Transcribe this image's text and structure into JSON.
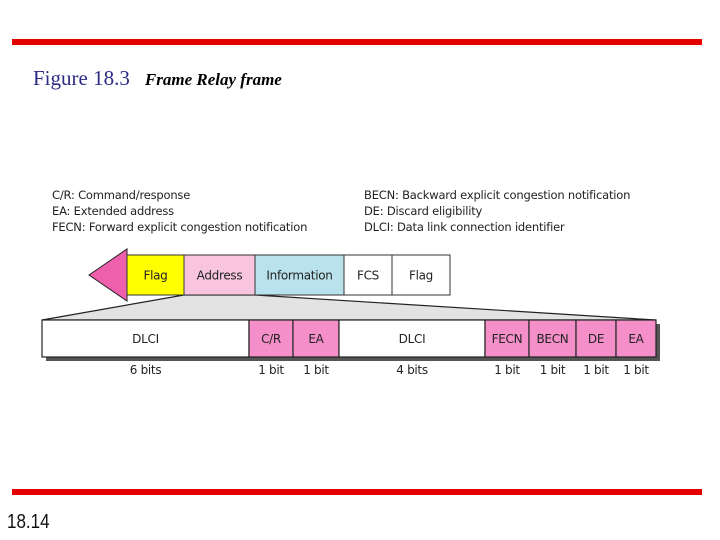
{
  "header": {
    "figure_number": "Figure 18.3",
    "figure_caption": "Frame Relay frame"
  },
  "legend": {
    "left": [
      "C/R: Command/response",
      "EA: Extended address",
      "FECN: Forward explicit congestion notification"
    ],
    "right": [
      "BECN: Backward explicit congestion notification",
      "DE: Discard eligibility",
      "DLCI: Data link connection identifier"
    ]
  },
  "frame": {
    "fields": [
      {
        "label": "Flag",
        "color": "#ffff00"
      },
      {
        "label": "Address",
        "color": "#f9c4de"
      },
      {
        "label": "Information",
        "color": "#b9e2ec"
      },
      {
        "label": "FCS",
        "color": "#ffffff"
      },
      {
        "label": "Flag",
        "color": "#ffffff"
      }
    ],
    "arrow_color": "#ee5fac"
  },
  "address": {
    "fields": [
      {
        "label": "DLCI",
        "bits": "6 bits",
        "color": "#ffffff"
      },
      {
        "label": "C/R",
        "bits": "1 bit",
        "color": "#f58fc9"
      },
      {
        "label": "EA",
        "bits": "1 bit",
        "color": "#f58fc9"
      },
      {
        "label": "DLCI",
        "bits": "4 bits",
        "color": "#ffffff"
      },
      {
        "label": "FECN",
        "bits": "1 bit",
        "color": "#f58fc9"
      },
      {
        "label": "BECN",
        "bits": "1 bit",
        "color": "#f58fc9"
      },
      {
        "label": "DE",
        "bits": "1 bit",
        "color": "#f58fc9"
      },
      {
        "label": "EA",
        "bits": "1 bit",
        "color": "#f58fc9"
      }
    ]
  },
  "footer": {
    "page_number": "18.14"
  },
  "colors": {
    "rule": "#e50000",
    "title_number": "#2b2b85",
    "expansion_fill": "#e3e3e3"
  }
}
